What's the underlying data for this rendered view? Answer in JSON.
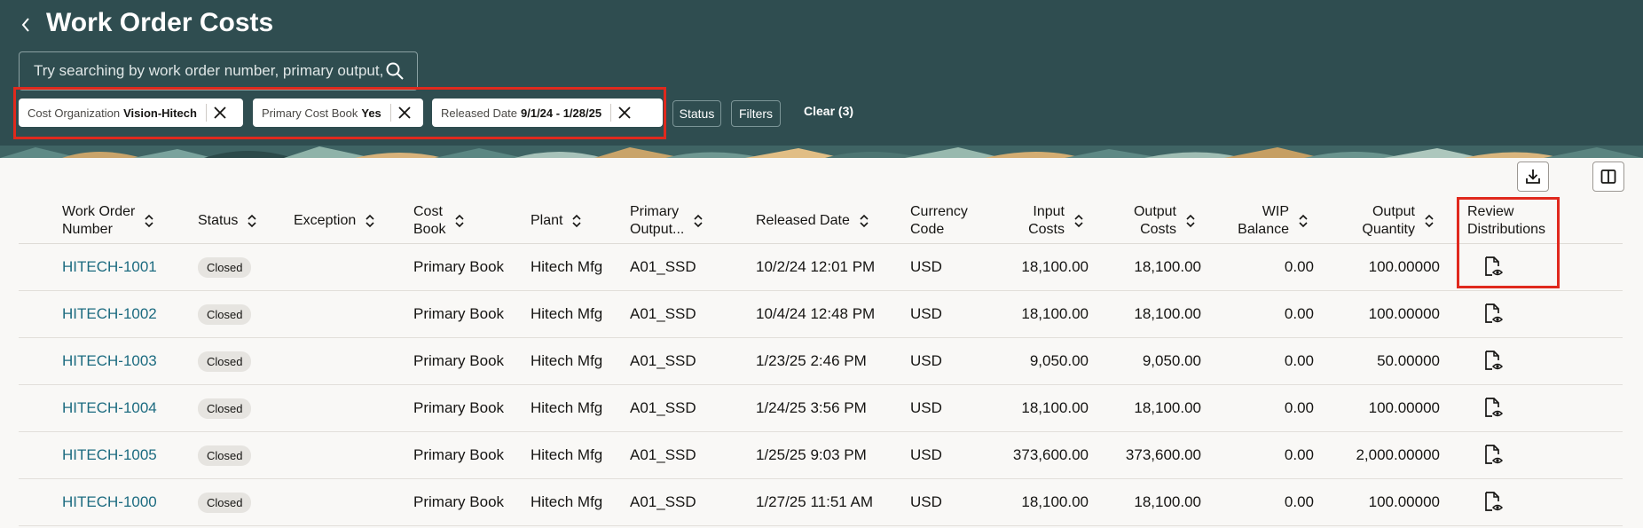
{
  "page": {
    "title": "Work Order Costs",
    "back_icon": "chevron-left-icon"
  },
  "search": {
    "placeholder": "Try searching by work order number, primary output, work",
    "value": "",
    "icon": "search-icon"
  },
  "filters": {
    "chips": [
      {
        "label": "Cost Organization",
        "value": "Vision-Hitech"
      },
      {
        "label": "Primary Cost Book",
        "value": "Yes"
      },
      {
        "label": "Released Date",
        "value": "9/1/24 - 1/28/25"
      }
    ],
    "status_label": "Status",
    "filters_label": "Filters",
    "clear_label": "Clear (3)"
  },
  "toolbar": {
    "export_icon": "download-icon",
    "columns_icon": "column-layout-icon"
  },
  "table": {
    "columns": [
      "Work Order\nNumber",
      "Status",
      "Exception",
      "Cost\nBook",
      "Plant",
      "Primary\nOutput...",
      "Released Date",
      "Currency\nCode",
      "Input\nCosts",
      "Output\nCosts",
      "WIP\nBalance",
      "Output\nQuantity",
      "Review\nDistributions"
    ],
    "rows": [
      {
        "work_order": "HITECH-1001",
        "status": "Closed",
        "exception": "",
        "cost_book": "Primary Book",
        "plant": "Hitech Mfg",
        "primary_output": "A01_SSD",
        "released_date": "10/2/24 12:01 PM",
        "currency": "USD",
        "input_costs": "18,100.00",
        "output_costs": "18,100.00",
        "wip_balance": "0.00",
        "output_quantity": "100.00000"
      },
      {
        "work_order": "HITECH-1002",
        "status": "Closed",
        "exception": "",
        "cost_book": "Primary Book",
        "plant": "Hitech Mfg",
        "primary_output": "A01_SSD",
        "released_date": "10/4/24 12:48 PM",
        "currency": "USD",
        "input_costs": "18,100.00",
        "output_costs": "18,100.00",
        "wip_balance": "0.00",
        "output_quantity": "100.00000"
      },
      {
        "work_order": "HITECH-1003",
        "status": "Closed",
        "exception": "",
        "cost_book": "Primary Book",
        "plant": "Hitech Mfg",
        "primary_output": "A01_SSD",
        "released_date": "1/23/25 2:46 PM",
        "currency": "USD",
        "input_costs": "9,050.00",
        "output_costs": "9,050.00",
        "wip_balance": "0.00",
        "output_quantity": "50.00000"
      },
      {
        "work_order": "HITECH-1004",
        "status": "Closed",
        "exception": "",
        "cost_book": "Primary Book",
        "plant": "Hitech Mfg",
        "primary_output": "A01_SSD",
        "released_date": "1/24/25 3:56 PM",
        "currency": "USD",
        "input_costs": "18,100.00",
        "output_costs": "18,100.00",
        "wip_balance": "0.00",
        "output_quantity": "100.00000"
      },
      {
        "work_order": "HITECH-1005",
        "status": "Closed",
        "exception": "",
        "cost_book": "Primary Book",
        "plant": "Hitech Mfg",
        "primary_output": "A01_SSD",
        "released_date": "1/25/25 9:03 PM",
        "currency": "USD",
        "input_costs": "373,600.00",
        "output_costs": "373,600.00",
        "wip_balance": "0.00",
        "output_quantity": "2,000.00000"
      },
      {
        "work_order": "HITECH-1000",
        "status": "Closed",
        "exception": "",
        "cost_book": "Primary Book",
        "plant": "Hitech Mfg",
        "primary_output": "A01_SSD",
        "released_date": "1/27/25 11:51 AM",
        "currency": "USD",
        "input_costs": "18,100.00",
        "output_costs": "18,100.00",
        "wip_balance": "0.00",
        "output_quantity": "100.00000"
      }
    ],
    "review_icon": "document-view-icon"
  },
  "colors": {
    "header_bg": "#2f4d50",
    "link": "#1c6b80",
    "highlight": "#e0291d",
    "badge_bg": "#e6e4e0"
  }
}
